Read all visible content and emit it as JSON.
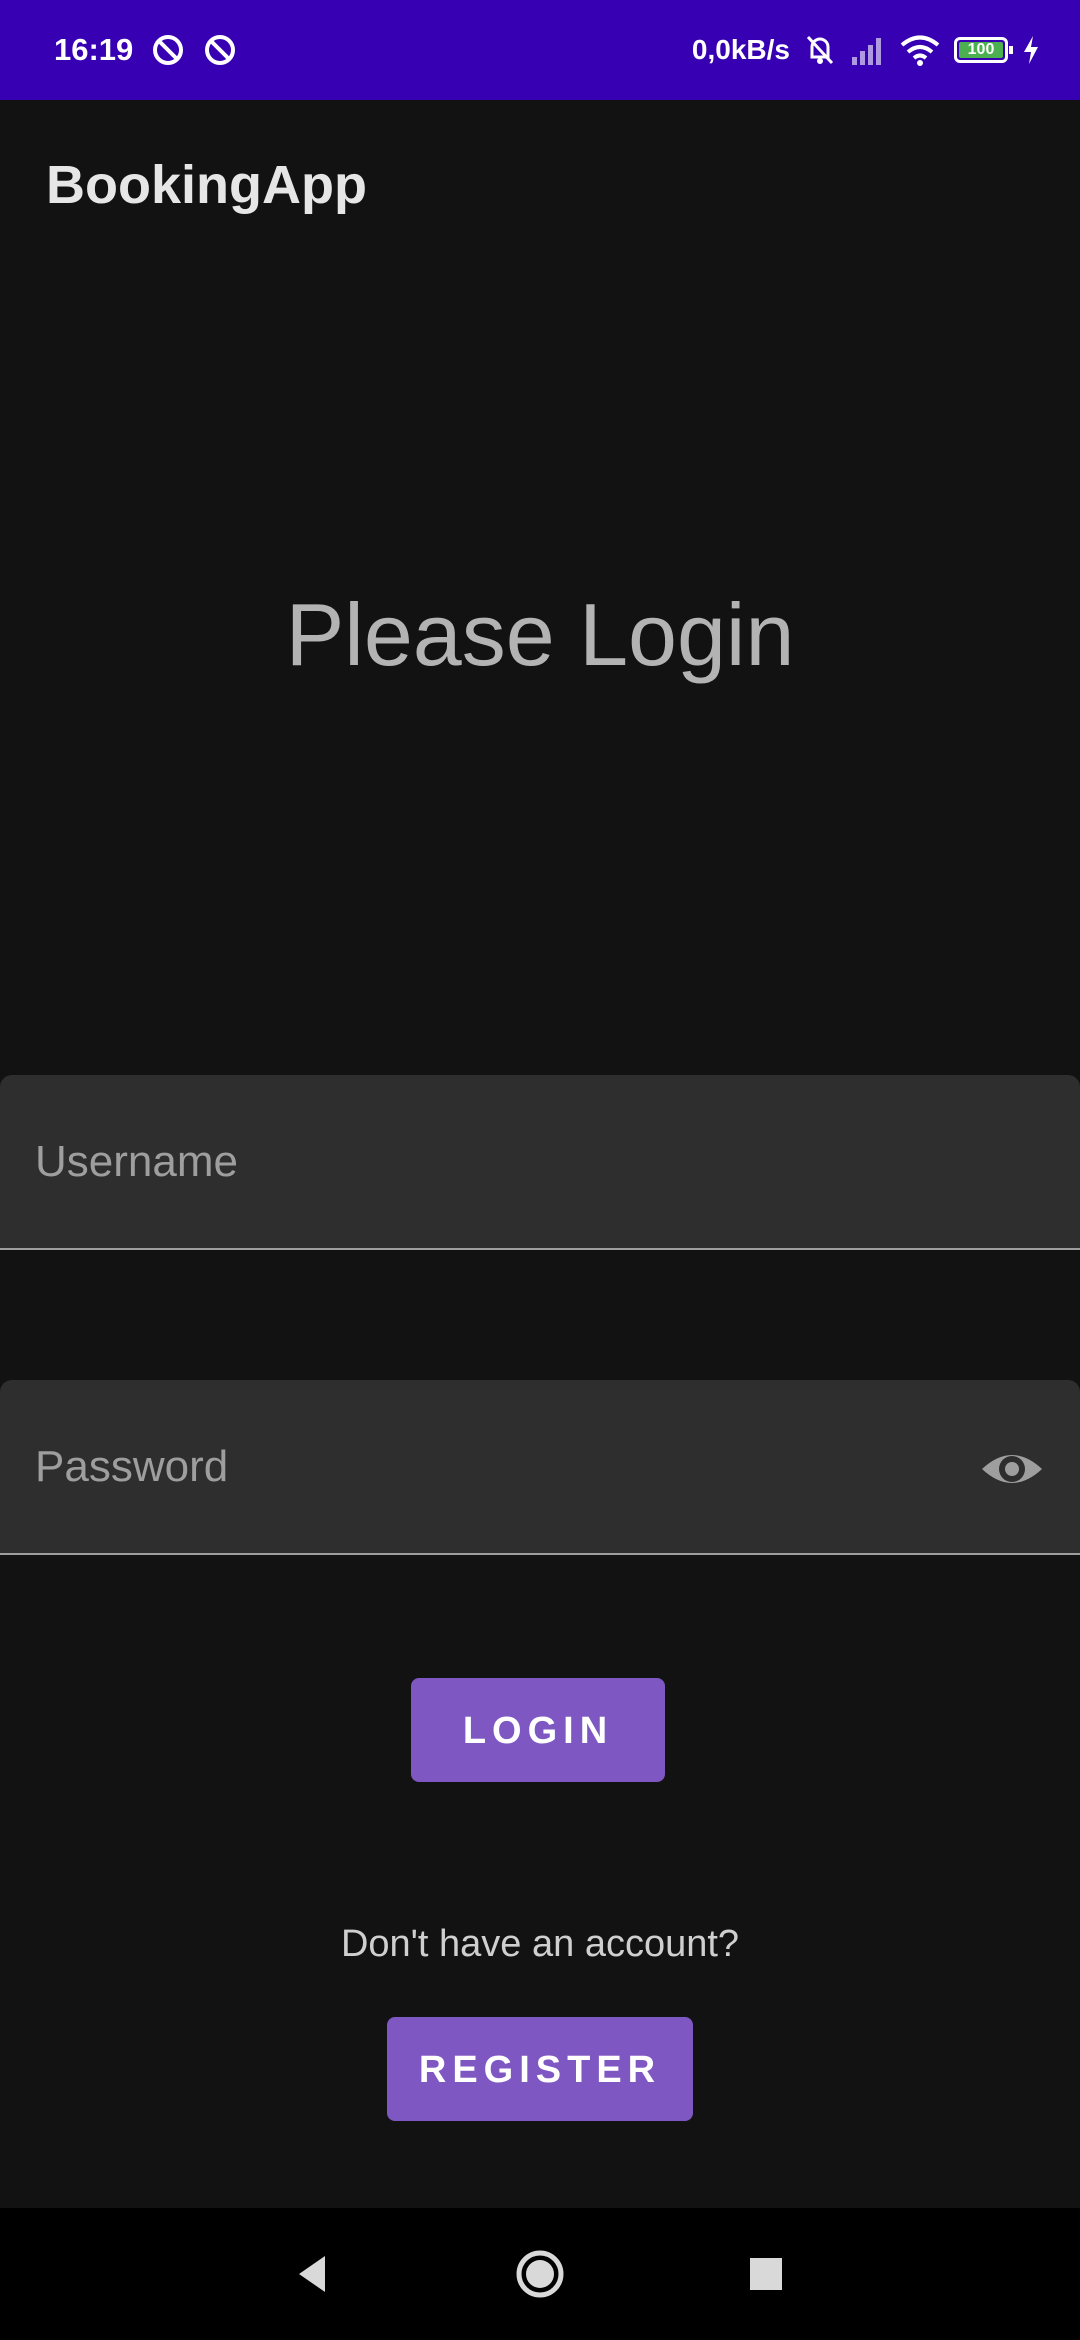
{
  "status_bar": {
    "time": "16:19",
    "net_speed": "0,0kB/s",
    "battery": "100",
    "icons": [
      "dnd-icon",
      "dnd-icon",
      "mute-icon",
      "signal-icon",
      "wifi-icon",
      "battery-icon",
      "charging-icon"
    ]
  },
  "app_bar": {
    "title": "BookingApp"
  },
  "main": {
    "heading": "Please Login",
    "username_label": "Username",
    "password_label": "Password",
    "login_label": "LOGIN",
    "signup_prompt": "Don't have an account?",
    "register_label": "REGISTER"
  },
  "colors": {
    "status_bar": "#3700b3",
    "background": "#121212",
    "field_bg": "#2e2e2e",
    "button": "#7e57c2"
  },
  "nav_bar": {
    "icons": [
      "back-icon",
      "home-icon",
      "recents-icon"
    ]
  }
}
